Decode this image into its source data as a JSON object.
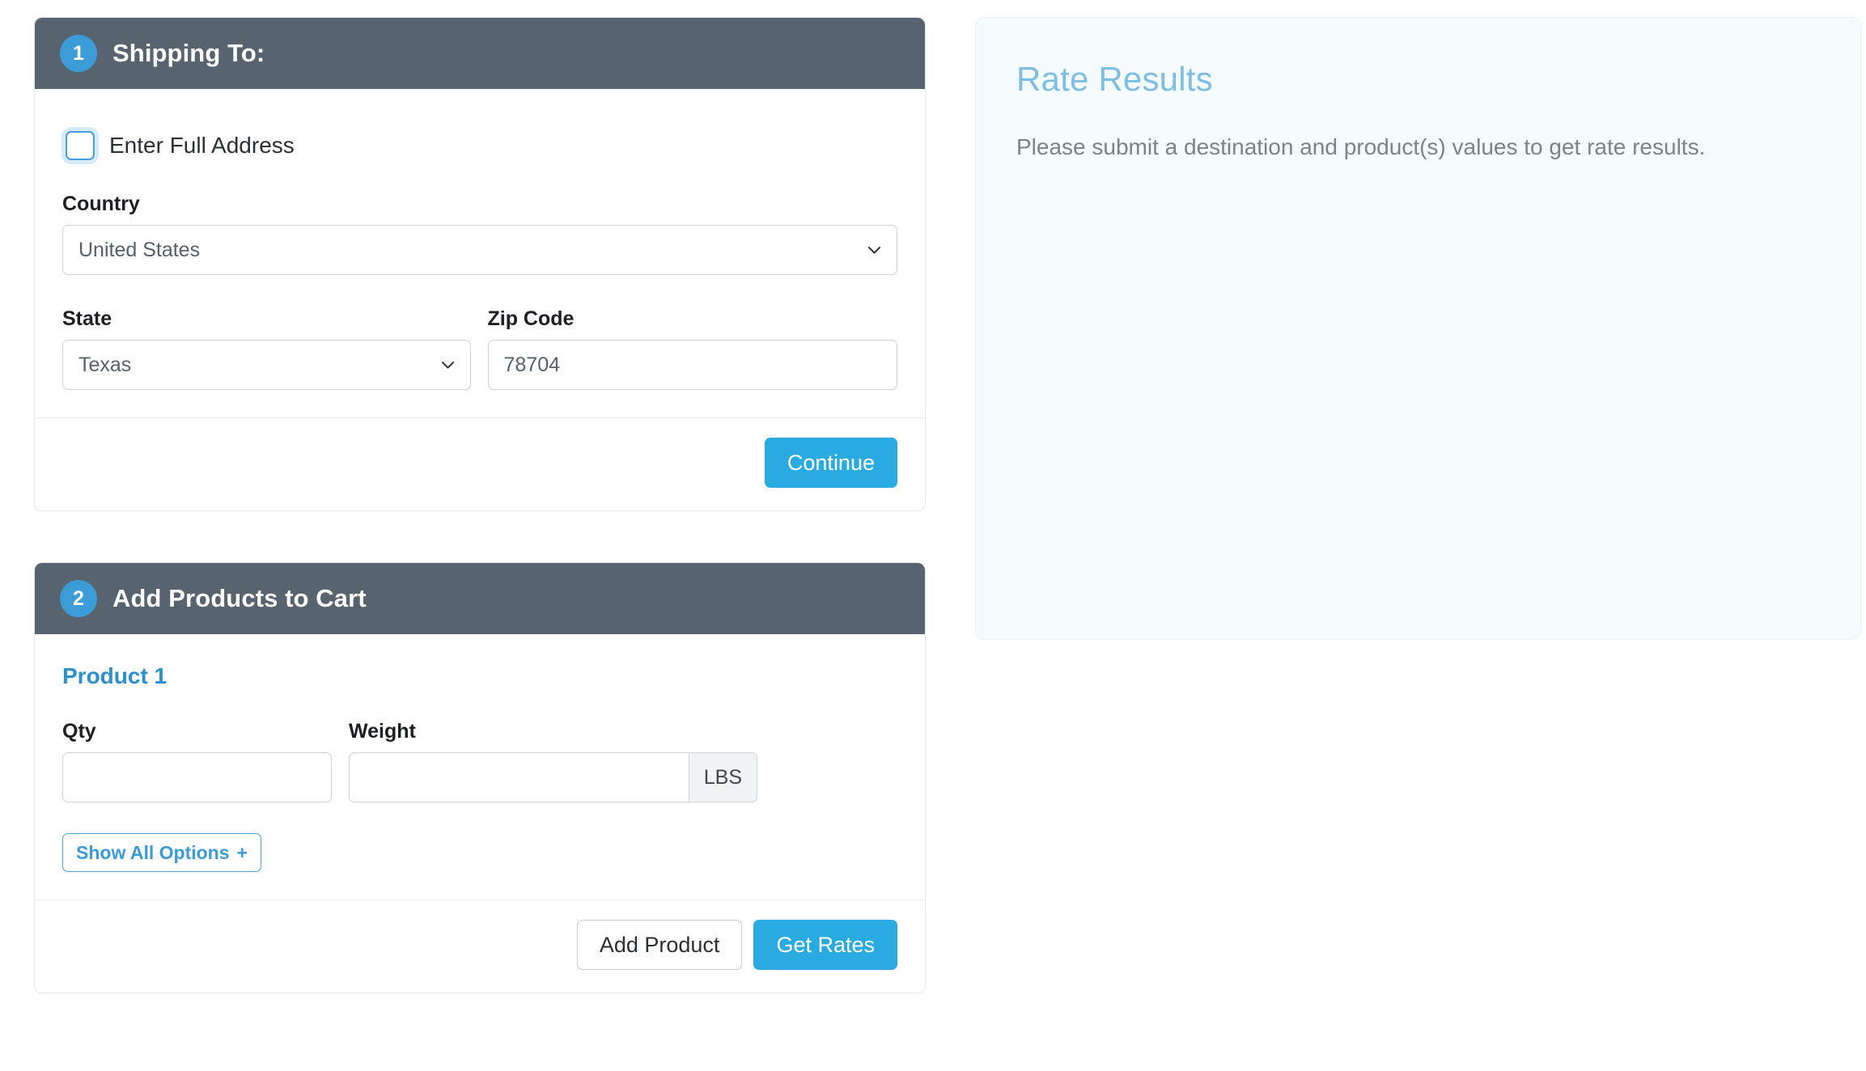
{
  "shipping_section": {
    "step_number": "1",
    "title": "Shipping To:",
    "full_address_checkbox_label": "Enter Full Address",
    "country": {
      "label": "Country",
      "value": "United States"
    },
    "state": {
      "label": "State",
      "value": "Texas"
    },
    "zip": {
      "label": "Zip Code",
      "value": "78704"
    },
    "continue_button": "Continue"
  },
  "products_section": {
    "step_number": "2",
    "title": "Add Products to Cart",
    "product_title": "Product 1",
    "qty": {
      "label": "Qty",
      "value": ""
    },
    "weight": {
      "label": "Weight",
      "value": "",
      "unit": "LBS"
    },
    "show_all_options_button": "Show All Options",
    "show_all_options_plus": "+",
    "add_product_button": "Add Product",
    "get_rates_button": "Get Rates"
  },
  "rate_results": {
    "title": "Rate Results",
    "message": "Please submit a destination and product(s) values to get rate results."
  },
  "colors": {
    "header_slate": "#57646f",
    "primary_blue": "#29abe2",
    "badge_blue": "#3c9cd7",
    "link_blue": "#2b8fd0",
    "rate_title_blue": "#7ebde4",
    "panel_bg": "#f5fafd"
  }
}
